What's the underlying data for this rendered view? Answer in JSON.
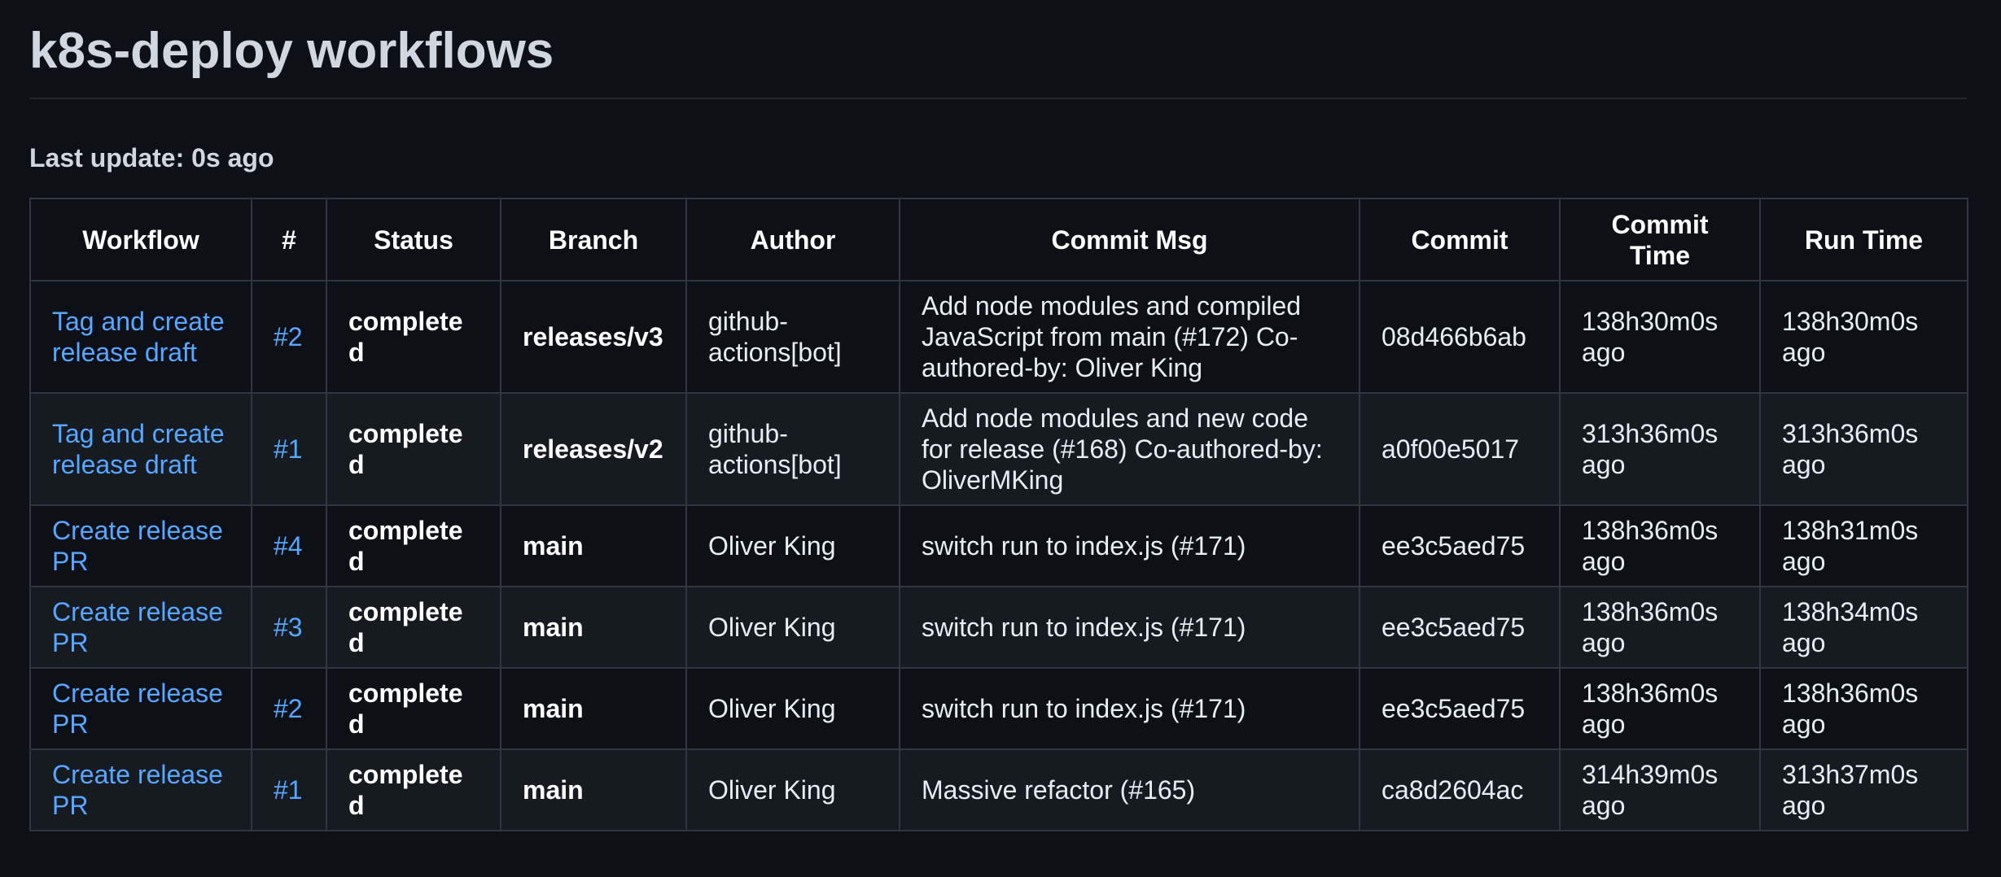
{
  "page": {
    "title": "k8s-deploy workflows",
    "last_update": "Last update: 0s ago"
  },
  "table": {
    "headers": [
      "Workflow",
      "#",
      "Status",
      "Branch",
      "Author",
      "Commit Msg",
      "Commit",
      "Commit Time",
      "Run Time"
    ],
    "rows": [
      {
        "workflow": "Tag and create release draft",
        "number": "#2",
        "status": "completed",
        "branch": "releases/v3",
        "author": "github-actions[bot]",
        "commit_msg": "Add node modules and compiled JavaScript from main (#172) Co-authored-by: Oliver King",
        "commit": "08d466b6ab",
        "commit_time": "138h30m0s ago",
        "run_time": "138h30m0s ago"
      },
      {
        "workflow": "Tag and create release draft",
        "number": "#1",
        "status": "completed",
        "branch": "releases/v2",
        "author": "github-actions[bot]",
        "commit_msg": "Add node modules and new code for release (#168) Co-authored-by: OliverMKing",
        "commit": "a0f00e5017",
        "commit_time": "313h36m0s ago",
        "run_time": "313h36m0s ago"
      },
      {
        "workflow": "Create release PR",
        "number": "#4",
        "status": "completed",
        "branch": "main",
        "author": "Oliver King",
        "commit_msg": "switch run to index.js (#171)",
        "commit": "ee3c5aed75",
        "commit_time": "138h36m0s ago",
        "run_time": "138h31m0s ago"
      },
      {
        "workflow": "Create release PR",
        "number": "#3",
        "status": "completed",
        "branch": "main",
        "author": "Oliver King",
        "commit_msg": "switch run to index.js (#171)",
        "commit": "ee3c5aed75",
        "commit_time": "138h36m0s ago",
        "run_time": "138h34m0s ago"
      },
      {
        "workflow": "Create release PR",
        "number": "#2",
        "status": "completed",
        "branch": "main",
        "author": "Oliver King",
        "commit_msg": "switch run to index.js (#171)",
        "commit": "ee3c5aed75",
        "commit_time": "138h36m0s ago",
        "run_time": "138h36m0s ago"
      },
      {
        "workflow": "Create release PR",
        "number": "#1",
        "status": "completed",
        "branch": "main",
        "author": "Oliver King",
        "commit_msg": "Massive refactor (#165)",
        "commit": "ca8d2604ac",
        "commit_time": "314h39m0s ago",
        "run_time": "313h37m0s ago"
      }
    ]
  },
  "colors": {
    "background": "#0d1117",
    "row_alt": "#161b22",
    "border": "#30363d",
    "link": "#58a6ff",
    "text": "#e6edf3"
  }
}
